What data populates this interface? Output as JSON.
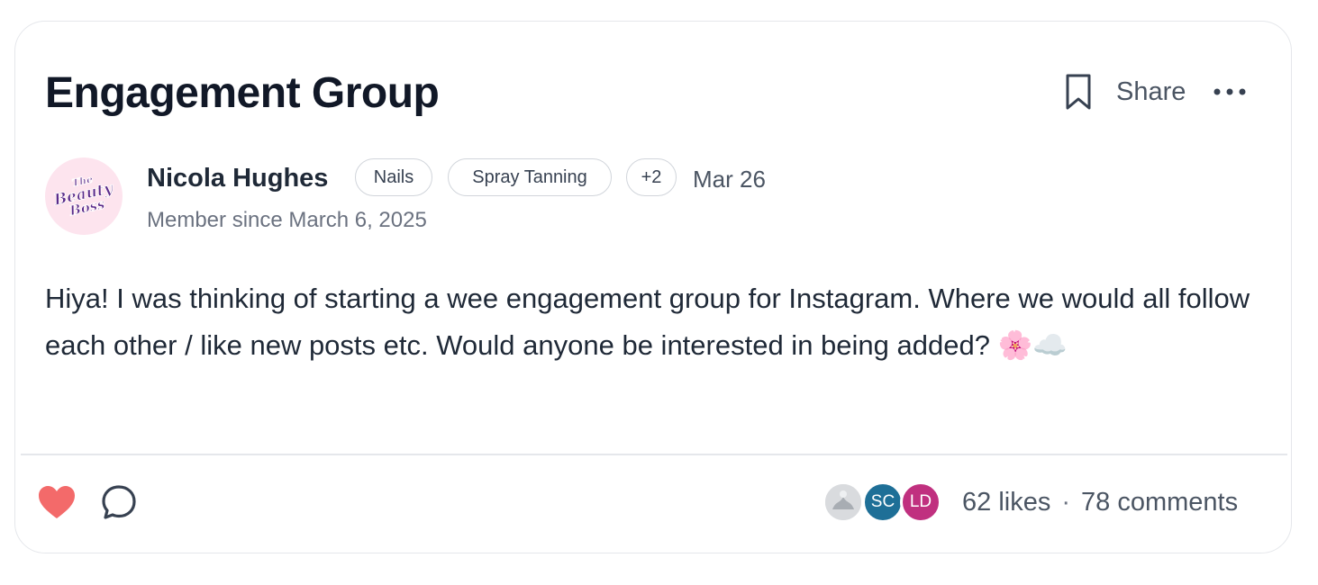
{
  "post": {
    "title": "Engagement Group",
    "share_label": "Share",
    "author": "Nicola Hughes",
    "avatar_text": "The Beauty Boss",
    "tags": [
      "Nails",
      "Spray Tanning",
      "+2"
    ],
    "date": "Mar 26",
    "member_since": "Member since March 6, 2025",
    "body": "Hiya! I was thinking of starting a wee engagement group for Instagram. Where we would all follow each other / like new posts etc. Would anyone be interested in being added? 🌸☁️"
  },
  "footer": {
    "likers": [
      {
        "initials": "",
        "color": "#cfd2d6"
      },
      {
        "initials": "SC",
        "color": "#1e6f97"
      },
      {
        "initials": "LD",
        "color": "#c0307f"
      }
    ],
    "likes_text": "62 likes",
    "separator": "·",
    "comments_text": "78 comments"
  },
  "icons": {
    "bookmark": "bookmark-icon",
    "more": "more-horizontal-icon",
    "like": "heart-icon",
    "comment": "comment-icon"
  },
  "colors": {
    "heart": "#f36a6a",
    "avatar_bg": "#fde4ee",
    "avatar_logo": "#5a2a8a"
  }
}
